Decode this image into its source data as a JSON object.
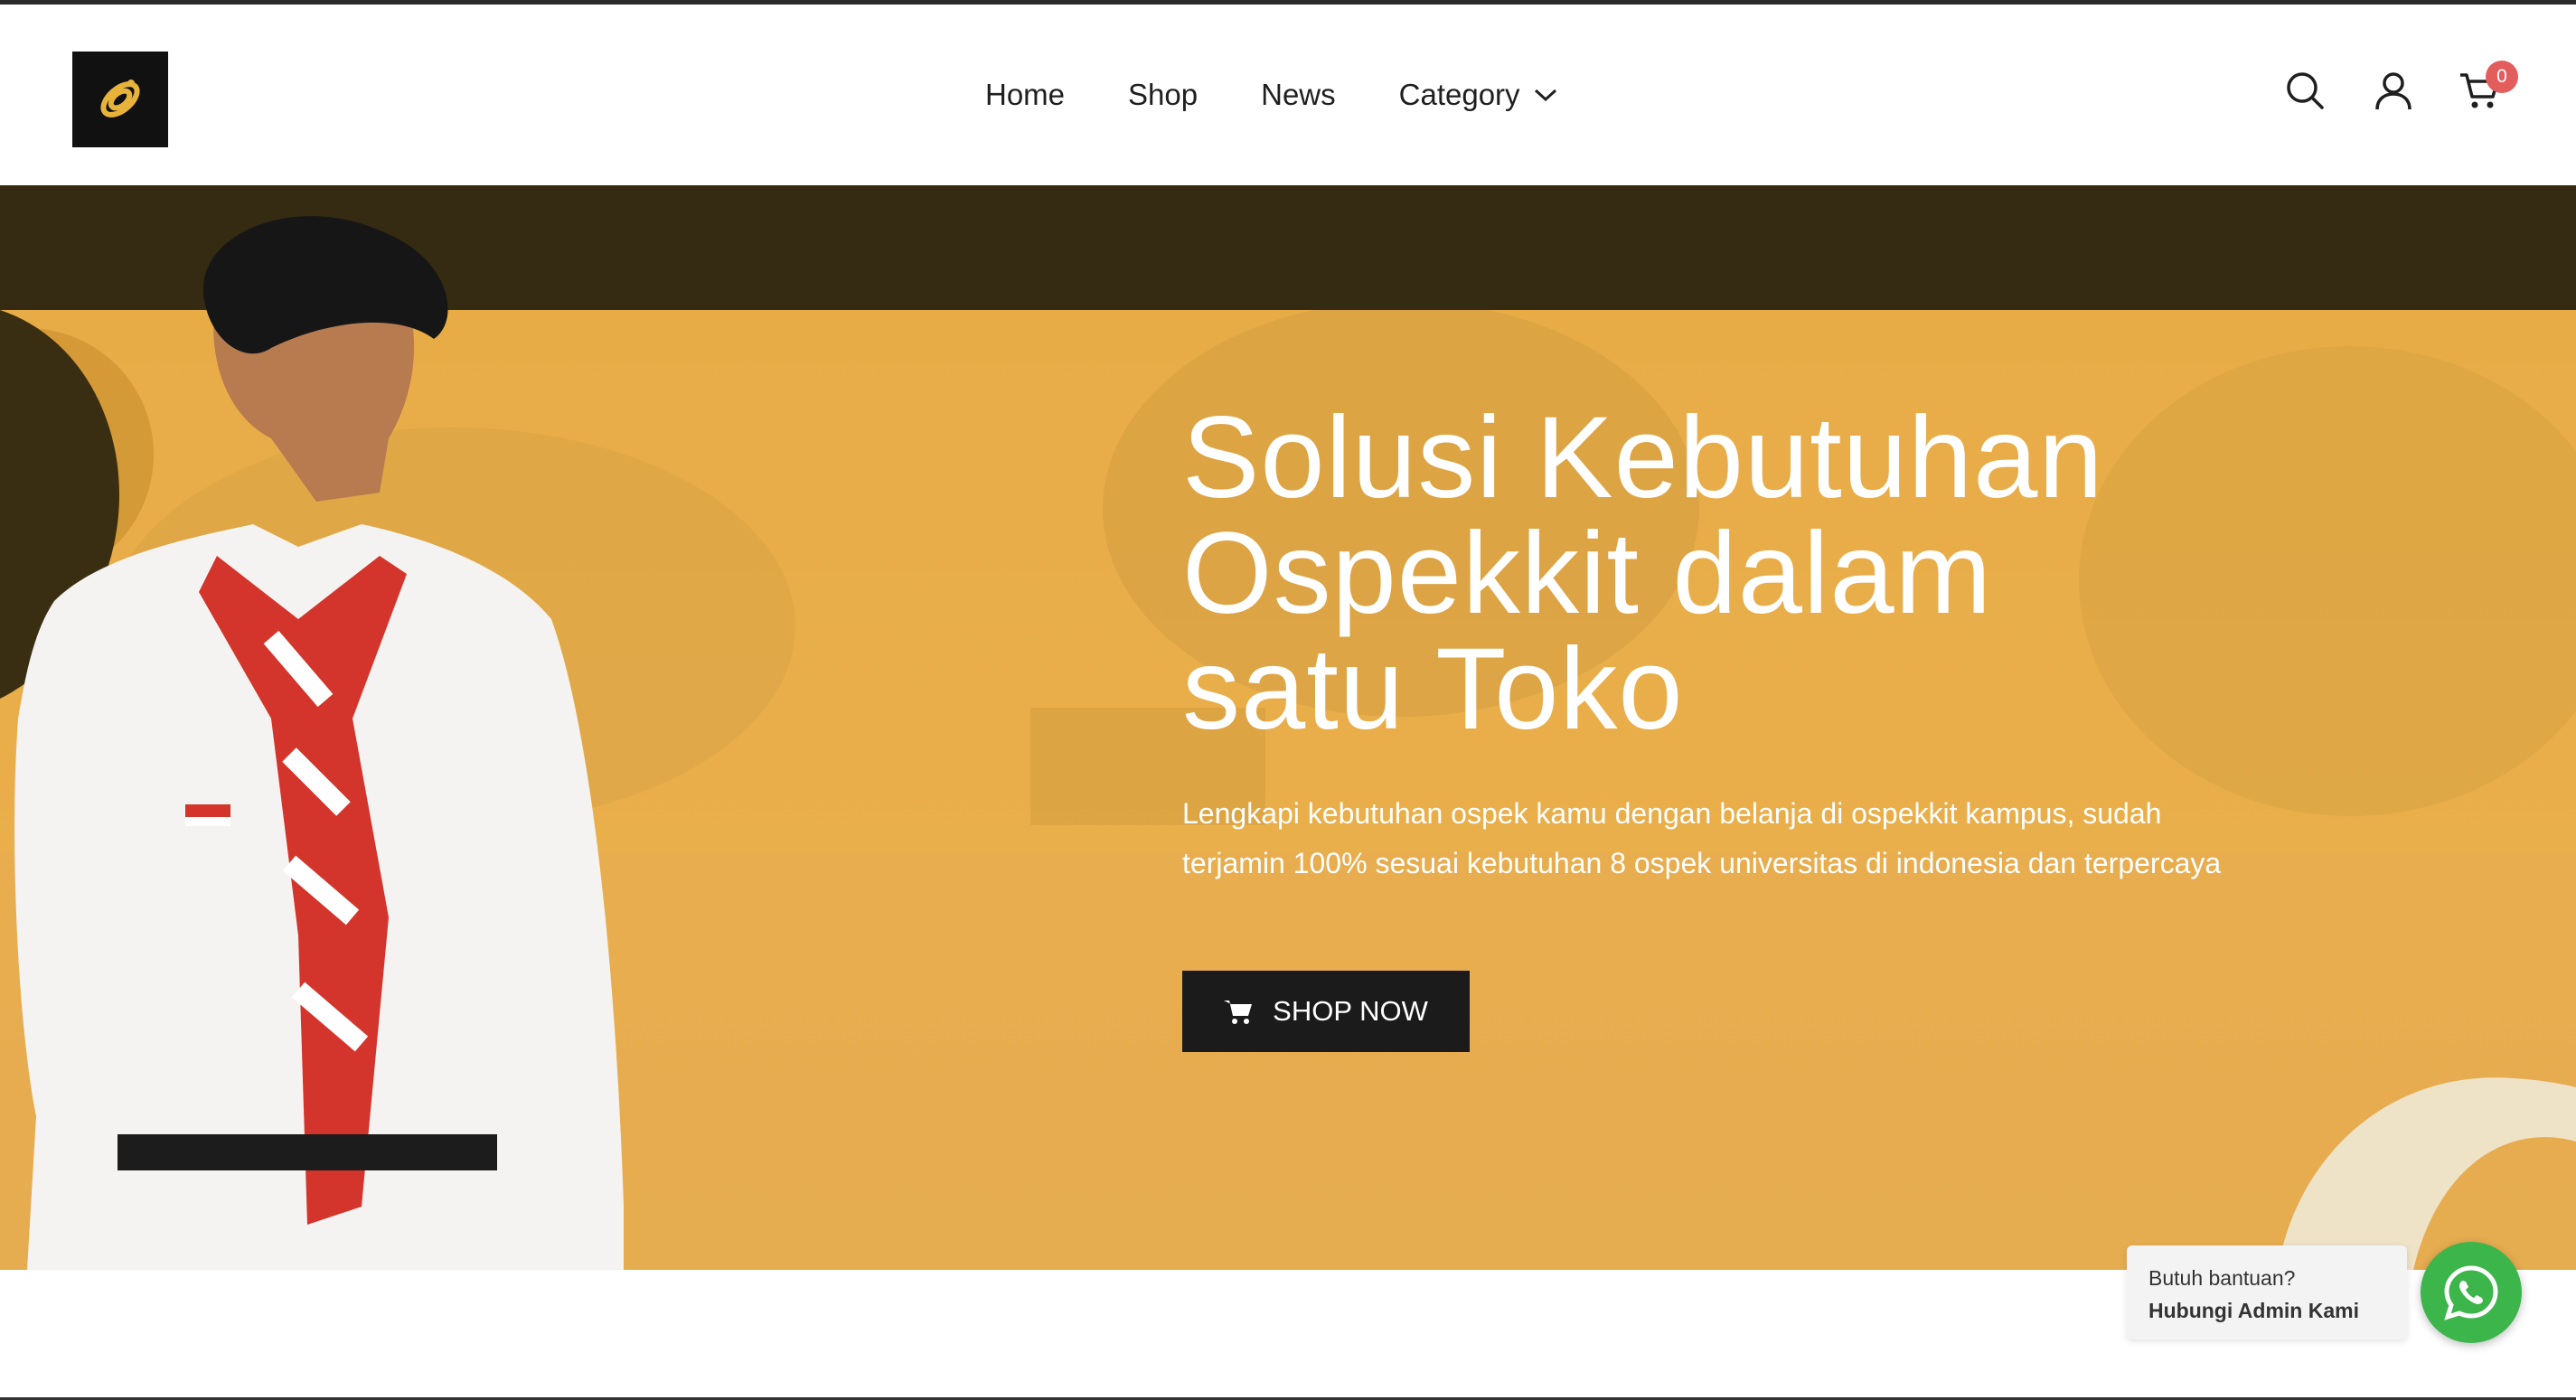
{
  "header": {
    "nav": [
      {
        "label": "Home"
      },
      {
        "label": "Shop"
      },
      {
        "label": "News"
      },
      {
        "label": "Category"
      }
    ],
    "cart_count": "0",
    "icons": [
      "logo-icon",
      "search-icon",
      "user-icon",
      "cart-icon",
      "chevron-down-icon"
    ]
  },
  "hero": {
    "title_lines": [
      "Solusi Kebutuhan",
      "Ospekkit dalam",
      "satu Toko"
    ],
    "description_lines": [
      "Lengkapi kebutuhan ospek kamu dengan belanja di ospekkit kampus, sudah",
      "terjamin 100% sesuai kebutuhan 8 ospek universitas di indonesia dan terpercaya"
    ],
    "button_label": "SHOP NOW"
  },
  "help": {
    "prefix": "Butuh bantuan? ",
    "bold": "Hubungi Admin Kami"
  },
  "colors": {
    "accent": "#e9af4b",
    "hero_top_band": "#342b12",
    "button": "#1b1b1b",
    "cart_badge": "#e35d5d",
    "whatsapp": "#3cb54a"
  }
}
